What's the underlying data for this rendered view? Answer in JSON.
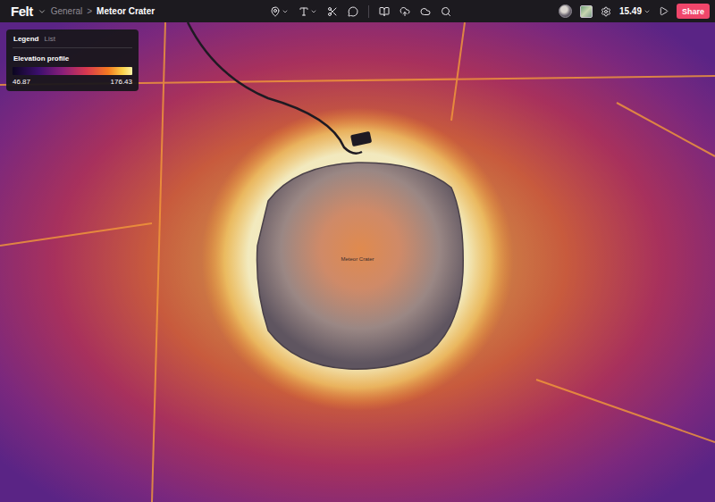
{
  "app": {
    "logo": "Felt"
  },
  "breadcrumb": [
    {
      "label": "General",
      "selected": false
    },
    {
      "label": "Meteor Crater",
      "selected": true
    }
  ],
  "breadcrumb_separator": ">",
  "zoom": "15.49",
  "share_button": "Share",
  "legend": {
    "tabs": [
      {
        "label": "Legend",
        "selected": true
      },
      {
        "label": "List",
        "selected": false
      }
    ],
    "title": "Elevation profile",
    "min": "46.87",
    "max": "176.43"
  },
  "map": {
    "label": "Meteor Crater"
  }
}
